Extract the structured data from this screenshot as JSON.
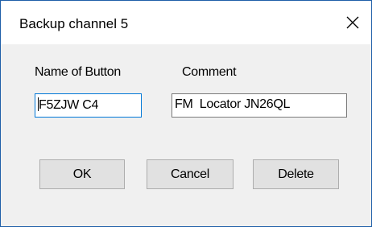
{
  "dialog": {
    "title": "Backup channel 5",
    "close_icon": "close-icon"
  },
  "form": {
    "name_label": "Name of Button",
    "comment_label": "Comment",
    "name_value": "F5ZJW C4",
    "comment_value": "FM  Locator JN26QL"
  },
  "buttons": {
    "ok": "OK",
    "cancel": "Cancel",
    "delete": "Delete"
  }
}
